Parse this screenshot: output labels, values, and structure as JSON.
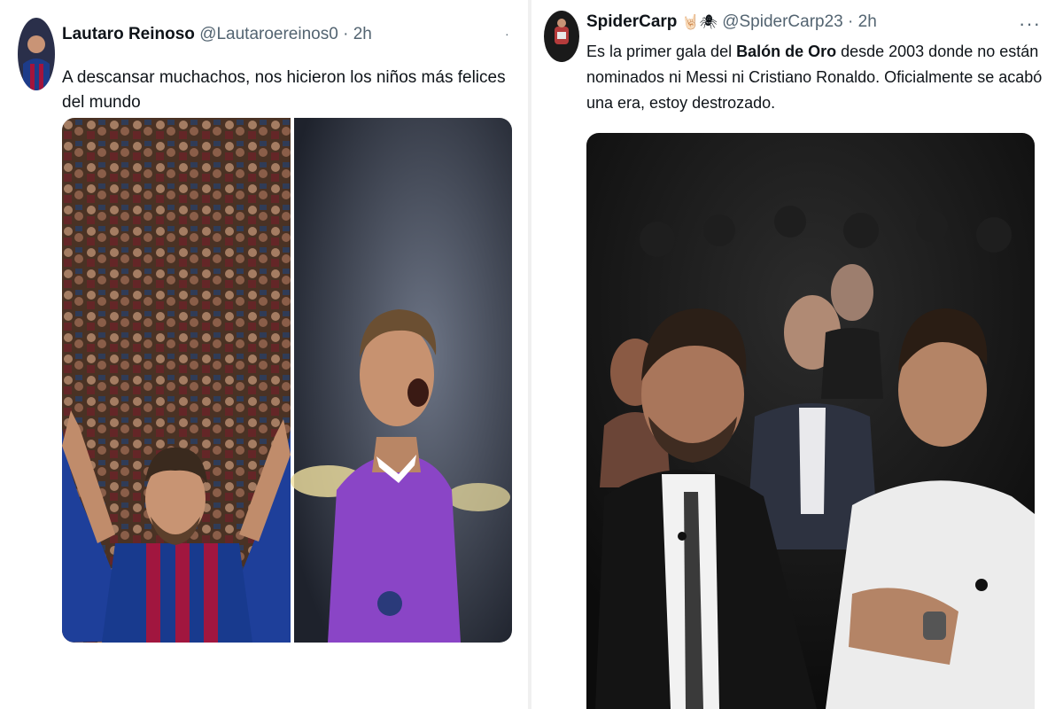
{
  "tweets": [
    {
      "display_name": "Lautaro Reinoso",
      "handle": "@Lautaroereinos0",
      "time": "· 2h",
      "text": "A descansar muchachos, nos hicieron los niños más felices del mundo"
    },
    {
      "display_name": "SpiderCarp",
      "emojis": "🤘🏻🕷",
      "handle": "@SpiderCarp23",
      "time": "· 2h",
      "text_pre": "Es la primer gala del ",
      "text_bold": "Balón de Oro",
      "text_post": " desde 2003 donde no están nominados ni Messi ni Cristiano Ronaldo. Oficialmente se acabó una era, estoy destrozado.",
      "more_label": "···"
    }
  ]
}
